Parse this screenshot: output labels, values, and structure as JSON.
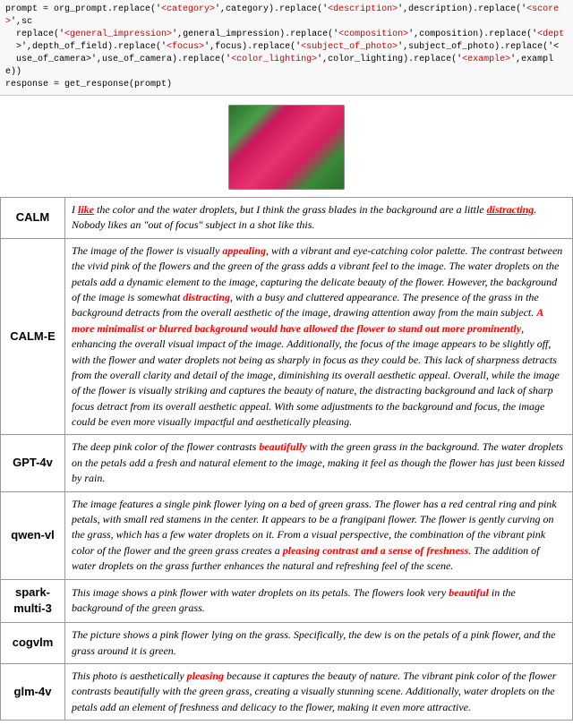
{
  "code": {
    "line1": "prompt = org_prompt.replace('<category>',category).replace('<description>',description).replace('<score>',sc",
    "line2": "  replace('<general_impression>',general_impression).replace('<composition>',composition).replace('<dept",
    "line3": "  >',depth_of_field).replace('<focus>',focus).replace('<subject_of_photo>',subject_of_photo).replace('<",
    "line4": "  use_of_camera>',use_of_camera).replace('<color_lighting>',color_lighting).replace('<example>',example))",
    "line5": "response = get_response(prompt)"
  },
  "models": [
    {
      "label": "CALM",
      "text_segments": [
        {
          "text": "I ",
          "style": "normal"
        },
        {
          "text": "like",
          "style": "red-bold-italic-underline"
        },
        {
          "text": " the color and the water droplets, but I think the grass blades in the background are a little ",
          "style": "normal"
        },
        {
          "text": "distracting",
          "style": "red-bold-underline"
        },
        {
          "text": ". Nobody likes an \"out of focus\" subject in a shot like this.",
          "style": "normal"
        }
      ]
    },
    {
      "label": "CALM-E",
      "text_segments": [
        {
          "text": "The image of the flower is visually ",
          "style": "normal"
        },
        {
          "text": "appealing",
          "style": "red-bold"
        },
        {
          "text": ", with a vibrant and eye-catching color palette. The contrast between the vivid pink of the flowers and the green of the grass adds a vibrant feel to the image. The water droplets on the petals add a dynamic element to the image, capturing the delicate beauty of the flower. However, the background of the image is somewhat ",
          "style": "normal"
        },
        {
          "text": "distracting",
          "style": "red-bold"
        },
        {
          "text": ", with a busy and cluttered appearance. The presence of the grass in the background detracts from the overall aesthetic of the image, drawing attention away from the main subject. ",
          "style": "normal"
        },
        {
          "text": "A more minimalist or blurred background would have allowed the flower to stand out more prominently",
          "style": "red-bold-italic"
        },
        {
          "text": ", enhancing the overall visual impact of the image. Additionally, the focus of the image appears to be slightly off, with the flower and water droplets not being as sharply in focus as they could be. This lack of sharpness detracts from the overall clarity and detail of the image, diminishing its overall aesthetic appeal. Overall, while the image of the flower is visually striking and captures the beauty of nature, the distracting background and lack of sharp focus detract from its overall aesthetic appeal. With some adjustments to the background and focus, the image could be even more visually impactful and aesthetically pleasing.",
          "style": "normal"
        }
      ]
    },
    {
      "label": "GPT-4v",
      "text_segments": [
        {
          "text": "The deep pink color of the flower contrasts ",
          "style": "normal"
        },
        {
          "text": "beautifully",
          "style": "red-bold"
        },
        {
          "text": " with the green grass in the background. The water droplets on the petals add a fresh and natural element to the image, making it feel as though the flower has just been kissed by rain.",
          "style": "normal"
        }
      ]
    },
    {
      "label": "qwen-vl",
      "text_segments": [
        {
          "text": "The image features a single pink flower lying on a bed of green grass. The flower has a red central ring and pink petals, with small red stamens in the center. It appears to be a frangipani flower. The flower is gently curving on the grass, which has a few water droplets on it. From a visual perspective, the combination of the vibrant pink color of the flower and the green grass creates a ",
          "style": "normal"
        },
        {
          "text": "pleasing contrast and a sense of freshness",
          "style": "red-bold"
        },
        {
          "text": ". The addition of water droplets on the grass further enhances the natural and refreshing feel of the scene.",
          "style": "normal"
        }
      ]
    },
    {
      "label": "spark-\nmulti-3",
      "text_segments": [
        {
          "text": "This image shows a pink flower with water droplets on its petals. The flowers look very ",
          "style": "normal"
        },
        {
          "text": "beautiful",
          "style": "red-bold"
        },
        {
          "text": " in the background of the green grass.",
          "style": "normal"
        }
      ]
    },
    {
      "label": "cogvlm",
      "text_segments": [
        {
          "text": "The picture shows a pink flower lying on the grass. Specifically, the dew is on the petals of a pink flower, and the grass around it is green.",
          "style": "normal"
        }
      ]
    },
    {
      "label": "glm-4v",
      "text_segments": [
        {
          "text": "This photo is aesthetically ",
          "style": "normal"
        },
        {
          "text": "pleasing",
          "style": "red-bold"
        },
        {
          "text": " because it captures the beauty of nature. The vibrant pink color of the flower contrasts beautifully with the green grass, creating a visually stunning scene. Additionally, water droplets on the petals add an element of freshness and delicacy to the flower, making it even more attractive.",
          "style": "normal"
        }
      ]
    }
  ]
}
